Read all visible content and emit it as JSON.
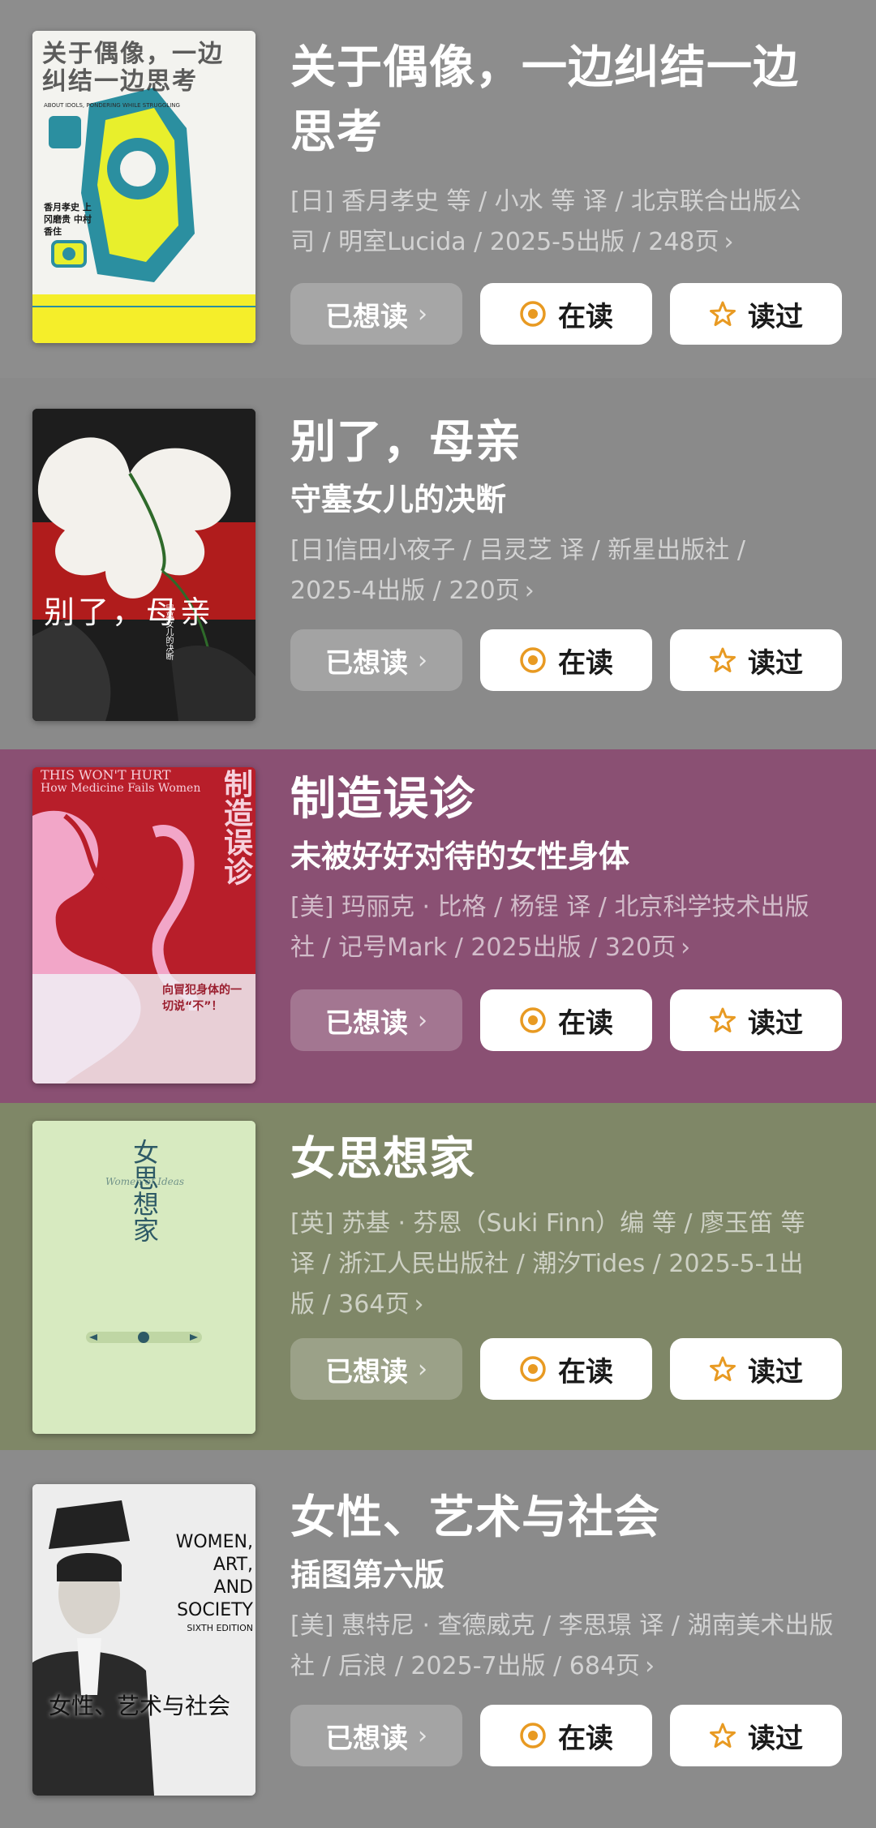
{
  "colors": {
    "card1_bg": "#8d8d8d",
    "card2_bg": "#8a8a8a",
    "card3_bg": "#8a5073",
    "card4_bg": "#7f8767",
    "card5_bg": "#8b8b8b",
    "button_white": "#ffffff",
    "button_icon": "#e89a22"
  },
  "buttons": {
    "want": "已想读",
    "reading": "在读",
    "read": "读过"
  },
  "books": [
    {
      "title": "关于偶像，一边纠结一边思考",
      "title_line1": "关于偶像，一边纠结一边",
      "title_line2": "思考",
      "subtitle": "",
      "meta_line1": "[日] 香月孝史 等 / 小水 等 译 / 北京联合出版公",
      "meta_line2": "司 / 明室Lucida / 2025-5出版 / 248页",
      "cover_title": "关于偶像，一边纠结一边思考",
      "cover_subtitle": "ABOUT IDOLS, PONDERING WHILE STRUGGLING",
      "cover_authors": "香月孝史 上冈磨贵 中村香住"
    },
    {
      "title": "别了，母亲",
      "subtitle": "守墓女儿的决断",
      "meta_line1": "[日]信田小夜子 / 吕灵芝 译 / 新星出版社 /",
      "meta_line2": "2025-4出版 / 220页",
      "cover_title": "别了，母亲",
      "cover_subtitle": "守墓女儿的决断"
    },
    {
      "title": "制造误诊",
      "subtitle": "未被好好对待的女性身体",
      "meta_line1": "[美] 玛丽克 · 比格 / 杨锃 译 / 北京科学技术出版",
      "meta_line2": "社 / 记号Mark / 2025出版 / 320页",
      "cover_title": "制造误诊",
      "cover_en1": "THIS WON'T HURT",
      "cover_en2": "How Medicine Fails Women",
      "cover_quote": "向冒犯身体的一切说“不”！"
    },
    {
      "title": "女思想家",
      "subtitle": "",
      "meta_line1": "[英] 苏基 · 芬恩（Suki Finn）编 等 / 廖玉笛 等",
      "meta_line2": "译 / 浙江人民出版社 / 潮汐Tides / 2025-5-1出",
      "meta_line3": "版 / 364页",
      "cover_title": "女思想家",
      "cover_en": "Women of Ideas"
    },
    {
      "title": "女性、艺术与社会",
      "subtitle": "插图第六版",
      "meta_line1": "[美] 惠特尼 · 查德威克 / 李思璟 译 / 湖南美术出版",
      "meta_line2": "社 / 后浪 / 2025-7出版 / 684页",
      "cover_title": "女性、艺术与社会",
      "cover_en1": "WOMEN,",
      "cover_en2": "ART,",
      "cover_en3": "AND",
      "cover_en4": "SOCIETY",
      "cover_en5": "SIXTH EDITION"
    }
  ]
}
